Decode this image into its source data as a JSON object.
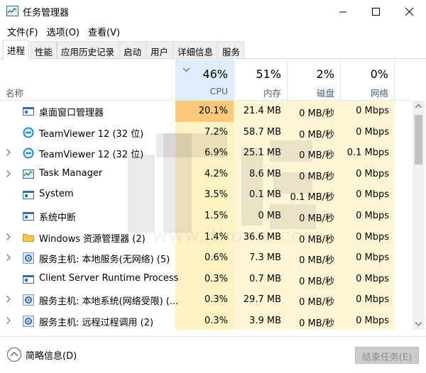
{
  "window": {
    "title": "任务管理器",
    "controls": {
      "minimize": "minimize",
      "maximize": "maximize",
      "close": "close"
    }
  },
  "menu": [
    "文件(F)",
    "选项(O)",
    "查看(V)"
  ],
  "tabs": [
    "进程",
    "性能",
    "应用历史记录",
    "启动",
    "用户",
    "详细信息",
    "服务"
  ],
  "active_tab": "进程",
  "header": {
    "name_label": "名称",
    "columns": [
      {
        "pct": "46%",
        "label": "CPU",
        "sorted": true
      },
      {
        "pct": "51%",
        "label": "内存"
      },
      {
        "pct": "2%",
        "label": "磁盘"
      },
      {
        "pct": "0%",
        "label": "网络"
      }
    ]
  },
  "processes": [
    {
      "name": "桌面窗口管理器",
      "cpu": "20.1%",
      "mem": "21.4 MB",
      "disk": "0 MB/秒",
      "net": "0 Mbps",
      "expandable": false,
      "icon": "window-icon"
    },
    {
      "name": "TeamViewer 12 (32 位)",
      "cpu": "7.2%",
      "mem": "58.7 MB",
      "disk": "0 MB/秒",
      "net": "0 Mbps",
      "expandable": false,
      "icon": "teamviewer-icon"
    },
    {
      "name": "TeamViewer 12 (32 位)",
      "cpu": "6.9%",
      "mem": "25.1 MB",
      "disk": "0 MB/秒",
      "net": "0.1 Mbps",
      "expandable": true,
      "icon": "teamviewer-icon"
    },
    {
      "name": "Task Manager",
      "cpu": "4.2%",
      "mem": "8.6 MB",
      "disk": "0 MB/秒",
      "net": "0 Mbps",
      "expandable": true,
      "icon": "task-manager-icon"
    },
    {
      "name": "System",
      "cpu": "3.5%",
      "mem": "0.1 MB",
      "disk": "0.1 MB/秒",
      "net": "0 Mbps",
      "expandable": false,
      "icon": "window-icon"
    },
    {
      "name": "系统中断",
      "cpu": "1.5%",
      "mem": "0 MB",
      "disk": "0 MB/秒",
      "net": "0 Mbps",
      "expandable": false,
      "icon": "window-icon"
    },
    {
      "name": "Windows 资源管理器 (2)",
      "cpu": "1.4%",
      "mem": "36.6 MB",
      "disk": "0 MB/秒",
      "net": "0 Mbps",
      "expandable": true,
      "icon": "folder-icon"
    },
    {
      "name": "服务主机: 本地服务(无网络) (5)",
      "cpu": "0.6%",
      "mem": "7.3 MB",
      "disk": "0 MB/秒",
      "net": "0 Mbps",
      "expandable": true,
      "icon": "gear-icon"
    },
    {
      "name": "Client Server Runtime Process",
      "cpu": "0.3%",
      "mem": "0.7 MB",
      "disk": "0 MB/秒",
      "net": "0 Mbps",
      "expandable": false,
      "icon": "window-icon"
    },
    {
      "name": "服务主机: 本地系统(网络受限) (...",
      "cpu": "0.3%",
      "mem": "29.7 MB",
      "disk": "0 MB/秒",
      "net": "0 Mbps",
      "expandable": true,
      "icon": "gear-icon"
    },
    {
      "name": "服务主机: 远程过程调用 (2)",
      "cpu": "0.3%",
      "mem": "3.9 MB",
      "disk": "0 MB/秒",
      "net": "0 Mbps",
      "expandable": true,
      "icon": "gear-icon"
    }
  ],
  "footer": {
    "fewer_details": "简略信息(D)",
    "end_task": "结束任务(E)"
  },
  "watermark": {
    "url": "www.ithome.com"
  },
  "colors": {
    "cpu_highlight": "#fbc77a",
    "cpu_column": "#fff2c4",
    "mem_column": "#fff6d6",
    "sorted_header": "#dfeefa",
    "accent_blue": "#0078d7"
  }
}
